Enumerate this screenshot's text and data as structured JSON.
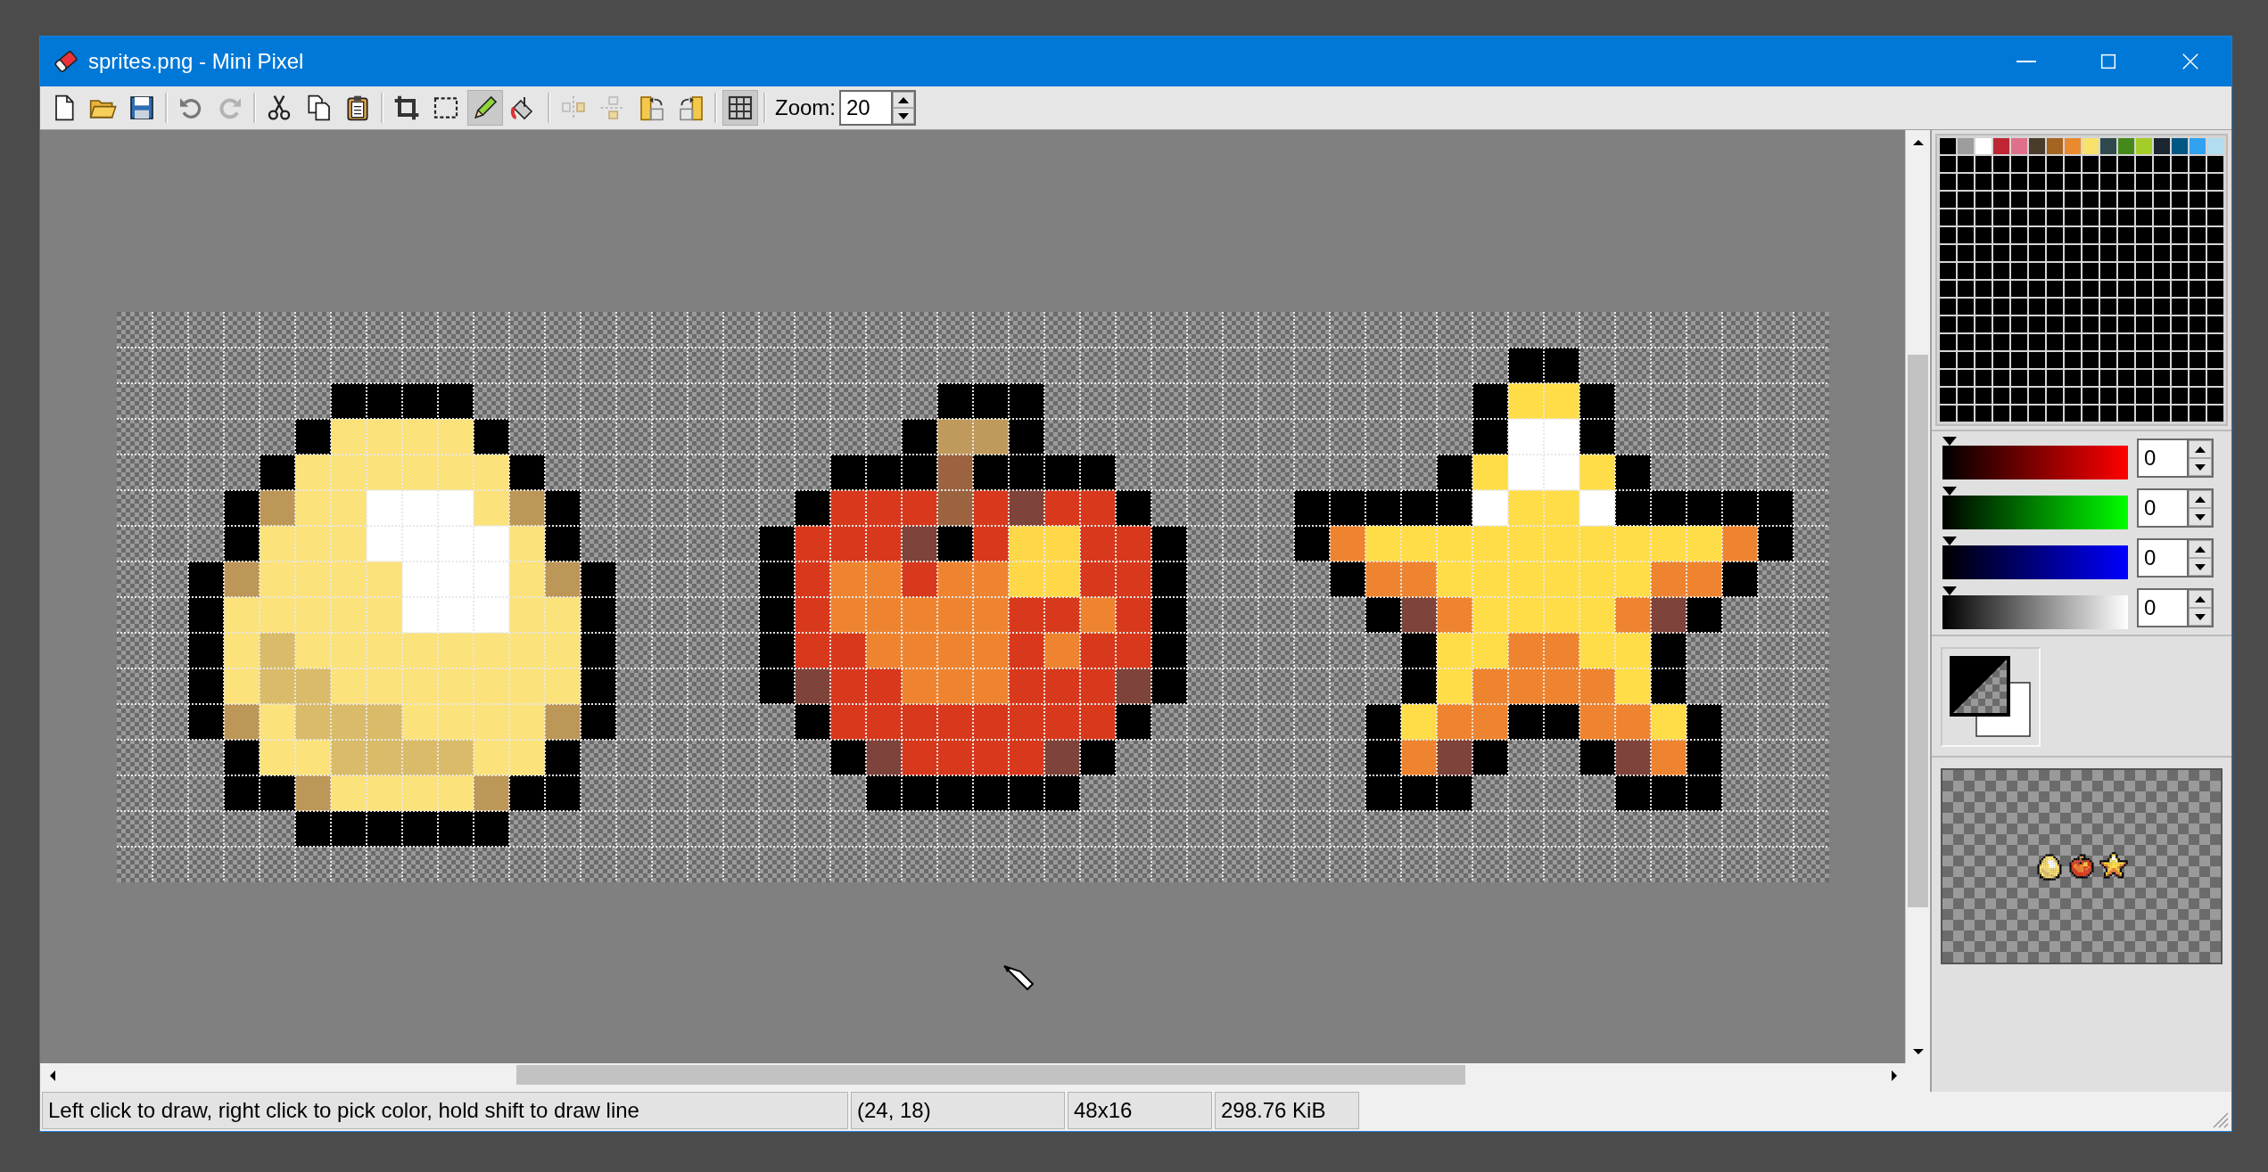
{
  "window": {
    "title": "sprites.png - Mini Pixel"
  },
  "toolbar": {
    "groups": [
      [
        {
          "kind": "new",
          "disabled": false,
          "pressed": false
        },
        {
          "kind": "open",
          "disabled": false,
          "pressed": false
        },
        {
          "kind": "save",
          "disabled": false,
          "pressed": false
        }
      ],
      [
        {
          "kind": "undo",
          "disabled": false,
          "pressed": false
        },
        {
          "kind": "redo",
          "disabled": true,
          "pressed": false
        }
      ],
      [
        {
          "kind": "cut",
          "disabled": false,
          "pressed": false
        },
        {
          "kind": "copy",
          "disabled": false,
          "pressed": false
        },
        {
          "kind": "paste",
          "disabled": false,
          "pressed": false
        }
      ],
      [
        {
          "kind": "crop",
          "disabled": false,
          "pressed": false
        },
        {
          "kind": "select",
          "disabled": false,
          "pressed": false
        },
        {
          "kind": "pencil",
          "disabled": false,
          "pressed": true
        },
        {
          "kind": "fill",
          "disabled": false,
          "pressed": false
        }
      ],
      [
        {
          "kind": "flip-h",
          "disabled": true,
          "pressed": false
        },
        {
          "kind": "flip-v",
          "disabled": true,
          "pressed": false
        },
        {
          "kind": "rotate-left",
          "disabled": false,
          "pressed": false
        },
        {
          "kind": "rotate-right",
          "disabled": false,
          "pressed": false
        }
      ],
      [
        {
          "kind": "grid",
          "disabled": false,
          "pressed": true
        }
      ]
    ],
    "zoom": {
      "label": "Zoom:",
      "value": "20"
    }
  },
  "palette": {
    "swatches": [
      {
        "color": "#000000"
      },
      {
        "color": "#9d9d9d"
      },
      {
        "color": "#ffffff"
      },
      {
        "color": "#be2633"
      },
      {
        "color": "#e06f8b"
      },
      {
        "color": "#493c2b"
      },
      {
        "color": "#a46422"
      },
      {
        "color": "#eb8931"
      },
      {
        "color": "#f7e26b"
      },
      {
        "color": "#2f484e"
      },
      {
        "color": "#44891a"
      },
      {
        "color": "#a3ce27"
      },
      {
        "color": "#1b2632"
      },
      {
        "color": "#005784"
      },
      {
        "color": "#31a2f2"
      },
      {
        "color": "#b2dcef"
      },
      {
        "color": "#000000"
      },
      {
        "color": "#000000"
      },
      {
        "color": "#000000"
      },
      {
        "color": "#000000"
      },
      {
        "color": "#000000"
      },
      {
        "color": "#000000"
      },
      {
        "color": "#000000"
      },
      {
        "color": "#000000"
      },
      {
        "color": "#000000"
      },
      {
        "color": "#000000"
      },
      {
        "color": "#000000"
      },
      {
        "color": "#000000"
      },
      {
        "color": "#000000"
      },
      {
        "color": "#000000"
      },
      {
        "color": "#000000"
      },
      {
        "color": "#000000"
      },
      {
        "color": "#000000"
      },
      {
        "color": "#000000"
      },
      {
        "color": "#000000"
      },
      {
        "color": "#000000"
      },
      {
        "color": "#000000"
      },
      {
        "color": "#000000"
      },
      {
        "color": "#000000"
      },
      {
        "color": "#000000"
      },
      {
        "color": "#000000"
      },
      {
        "color": "#000000"
      },
      {
        "color": "#000000"
      },
      {
        "color": "#000000"
      },
      {
        "color": "#000000"
      },
      {
        "color": "#000000"
      },
      {
        "color": "#000000"
      },
      {
        "color": "#000000"
      },
      {
        "color": "#000000"
      },
      {
        "color": "#000000"
      },
      {
        "color": "#000000"
      },
      {
        "color": "#000000"
      },
      {
        "color": "#000000"
      },
      {
        "color": "#000000"
      },
      {
        "color": "#000000"
      },
      {
        "color": "#000000"
      },
      {
        "color": "#000000"
      },
      {
        "color": "#000000"
      },
      {
        "color": "#000000"
      },
      {
        "color": "#000000"
      },
      {
        "color": "#000000"
      },
      {
        "color": "#000000"
      },
      {
        "color": "#000000"
      },
      {
        "color": "#000000"
      },
      {
        "color": "#000000"
      },
      {
        "color": "#000000"
      },
      {
        "color": "#000000"
      },
      {
        "color": "#000000"
      },
      {
        "color": "#000000"
      },
      {
        "color": "#000000"
      },
      {
        "color": "#000000"
      },
      {
        "color": "#000000"
      },
      {
        "color": "#000000"
      },
      {
        "color": "#000000"
      },
      {
        "color": "#000000"
      },
      {
        "color": "#000000"
      },
      {
        "color": "#000000"
      },
      {
        "color": "#000000"
      },
      {
        "color": "#000000"
      },
      {
        "color": "#000000"
      },
      {
        "color": "#000000"
      },
      {
        "color": "#000000"
      },
      {
        "color": "#000000"
      },
      {
        "color": "#000000"
      },
      {
        "color": "#000000"
      },
      {
        "color": "#000000"
      },
      {
        "color": "#000000"
      },
      {
        "color": "#000000"
      },
      {
        "color": "#000000"
      },
      {
        "color": "#000000"
      },
      {
        "color": "#000000"
      },
      {
        "color": "#000000"
      },
      {
        "color": "#000000"
      },
      {
        "color": "#000000"
      },
      {
        "color": "#000000"
      },
      {
        "color": "#000000"
      },
      {
        "color": "#000000"
      },
      {
        "color": "#000000"
      },
      {
        "color": "#000000"
      },
      {
        "color": "#000000"
      },
      {
        "color": "#000000"
      },
      {
        "color": "#000000"
      },
      {
        "color": "#000000"
      },
      {
        "color": "#000000"
      },
      {
        "color": "#000000"
      },
      {
        "color": "#000000"
      },
      {
        "color": "#000000"
      },
      {
        "color": "#000000"
      },
      {
        "color": "#000000"
      },
      {
        "color": "#000000"
      },
      {
        "color": "#000000"
      },
      {
        "color": "#000000"
      },
      {
        "color": "#000000"
      },
      {
        "color": "#000000"
      },
      {
        "color": "#000000"
      },
      {
        "color": "#000000"
      },
      {
        "color": "#000000"
      },
      {
        "color": "#000000"
      },
      {
        "color": "#000000"
      },
      {
        "color": "#000000"
      },
      {
        "color": "#000000"
      },
      {
        "color": "#000000"
      },
      {
        "color": "#000000"
      },
      {
        "color": "#000000"
      },
      {
        "color": "#000000"
      },
      {
        "color": "#000000"
      },
      {
        "color": "#000000"
      },
      {
        "color": "#000000"
      },
      {
        "color": "#000000"
      },
      {
        "color": "#000000"
      },
      {
        "color": "#000000"
      },
      {
        "color": "#000000"
      },
      {
        "color": "#000000"
      },
      {
        "color": "#000000"
      },
      {
        "color": "#000000"
      },
      {
        "color": "#000000"
      },
      {
        "color": "#000000"
      },
      {
        "color": "#000000"
      },
      {
        "color": "#000000"
      },
      {
        "color": "#000000"
      },
      {
        "color": "#000000"
      },
      {
        "color": "#000000"
      },
      {
        "color": "#000000"
      },
      {
        "color": "#000000"
      },
      {
        "color": "#000000"
      },
      {
        "color": "#000000"
      },
      {
        "color": "#000000"
      },
      {
        "color": "#000000"
      },
      {
        "color": "#000000"
      },
      {
        "color": "#000000"
      },
      {
        "color": "#000000"
      },
      {
        "color": "#000000"
      },
      {
        "color": "#000000"
      },
      {
        "color": "#000000"
      },
      {
        "color": "#000000"
      },
      {
        "color": "#000000"
      },
      {
        "color": "#000000"
      },
      {
        "color": "#000000"
      },
      {
        "color": "#000000"
      },
      {
        "color": "#000000"
      },
      {
        "color": "#000000"
      },
      {
        "color": "#000000"
      },
      {
        "color": "#000000"
      },
      {
        "color": "#000000"
      },
      {
        "color": "#000000"
      },
      {
        "color": "#000000"
      },
      {
        "color": "#000000"
      },
      {
        "color": "#000000"
      },
      {
        "color": "#000000"
      },
      {
        "color": "#000000"
      },
      {
        "color": "#000000"
      },
      {
        "color": "#000000"
      },
      {
        "color": "#000000"
      },
      {
        "color": "#000000"
      },
      {
        "color": "#000000"
      },
      {
        "color": "#000000"
      },
      {
        "color": "#000000"
      },
      {
        "color": "#000000"
      },
      {
        "color": "#000000"
      },
      {
        "color": "#000000"
      },
      {
        "color": "#000000"
      },
      {
        "color": "#000000"
      },
      {
        "color": "#000000"
      },
      {
        "color": "#000000"
      },
      {
        "color": "#000000"
      },
      {
        "color": "#000000"
      },
      {
        "color": "#000000"
      },
      {
        "color": "#000000"
      },
      {
        "color": "#000000"
      },
      {
        "color": "#000000"
      },
      {
        "color": "#000000"
      },
      {
        "color": "#000000"
      },
      {
        "color": "#000000"
      },
      {
        "color": "#000000"
      },
      {
        "color": "#000000"
      },
      {
        "color": "#000000"
      },
      {
        "color": "#000000"
      },
      {
        "color": "#000000"
      },
      {
        "color": "#000000"
      },
      {
        "color": "#000000"
      },
      {
        "color": "#000000"
      },
      {
        "color": "#000000"
      },
      {
        "color": "#000000"
      },
      {
        "color": "#000000"
      },
      {
        "color": "#000000"
      },
      {
        "color": "#000000"
      },
      {
        "color": "#000000"
      },
      {
        "color": "#000000"
      },
      {
        "color": "#000000"
      },
      {
        "color": "#000000"
      },
      {
        "color": "#000000"
      },
      {
        "color": "#000000"
      },
      {
        "color": "#000000"
      },
      {
        "color": "#000000"
      },
      {
        "color": "#000000"
      },
      {
        "color": "#000000"
      },
      {
        "color": "#000000"
      },
      {
        "color": "#000000"
      },
      {
        "color": "#000000"
      },
      {
        "color": "#000000"
      },
      {
        "color": "#000000"
      },
      {
        "color": "#000000"
      },
      {
        "color": "#000000"
      },
      {
        "color": "#000000"
      },
      {
        "color": "#000000"
      },
      {
        "color": "#000000"
      },
      {
        "color": "#000000"
      },
      {
        "color": "#000000"
      },
      {
        "color": "#000000"
      },
      {
        "color": "#000000"
      },
      {
        "color": "#000000"
      },
      {
        "color": "#000000"
      },
      {
        "color": "#000000"
      },
      {
        "color": "#000000"
      },
      {
        "color": "#000000"
      },
      {
        "color": "#000000"
      },
      {
        "color": "#000000"
      },
      {
        "color": "#000000"
      },
      {
        "color": "#000000"
      },
      {
        "color": "#000000"
      },
      {
        "color": "#000000"
      },
      {
        "color": "#000000"
      },
      {
        "color": "#000000"
      },
      {
        "color": "#000000"
      },
      {
        "color": "#000000"
      },
      {
        "color": "#000000"
      },
      {
        "color": "#000000"
      },
      {
        "color": "#000000"
      },
      {
        "color": "#000000"
      },
      {
        "color": "#000000"
      },
      {
        "color": "#000000"
      },
      {
        "color": "#000000"
      },
      {
        "color": "#000000"
      },
      {
        "color": "#000000"
      },
      {
        "color": "#000000"
      },
      {
        "color": "#000000"
      }
    ]
  },
  "channels": [
    {
      "kind": "red",
      "level": 0,
      "value": "0"
    },
    {
      "kind": "green",
      "level": 0,
      "value": "0"
    },
    {
      "kind": "blue",
      "level": 0,
      "value": "0"
    },
    {
      "kind": "alpha",
      "level": 0,
      "value": "0"
    }
  ],
  "status_bar": [
    "Left click to draw, right click to pick color, hold shift to draw line",
    "(24, 18)",
    "48x16",
    "298.76 KiB"
  ]
}
